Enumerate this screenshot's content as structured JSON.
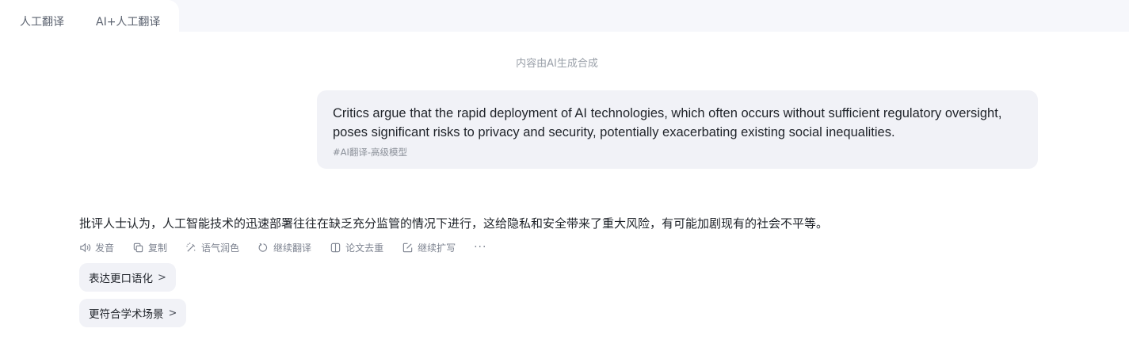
{
  "tabs": [
    {
      "label": "人工翻译"
    },
    {
      "label": "AI+人工翻译"
    }
  ],
  "ai_note": "内容由AI生成合成",
  "source": {
    "text": "Critics argue that the rapid deployment of AI technologies, which often occurs without sufficient regulatory oversight, poses significant risks to privacy and security, potentially exacerbating existing social inequalities.",
    "tag": "#AI翻译-高级模型"
  },
  "result": {
    "text": "批评人士认为，人工智能技术的迅速部署往往在缺乏充分监管的情况下进行，这给隐私和安全带来了重大风险，有可能加剧现有的社会不平等。"
  },
  "actions": [
    {
      "label": "发音",
      "icon": "speaker-icon"
    },
    {
      "label": "复制",
      "icon": "copy-icon"
    },
    {
      "label": "语气润色",
      "icon": "magic-wand-icon"
    },
    {
      "label": "继续翻译",
      "icon": "refresh-icon"
    },
    {
      "label": "论文去重",
      "icon": "book-icon"
    },
    {
      "label": "继续扩写",
      "icon": "edit-icon"
    }
  ],
  "more_label": "···",
  "suggestions": [
    {
      "label": "表达更口语化"
    },
    {
      "label": "更符合学术场景"
    }
  ]
}
